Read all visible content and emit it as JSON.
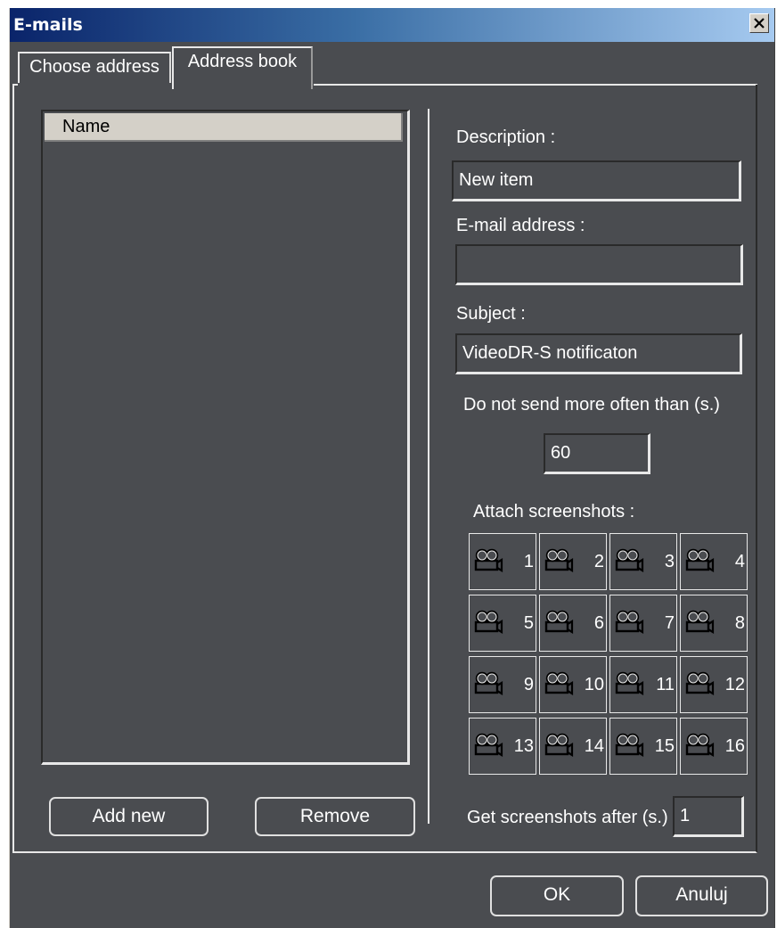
{
  "window": {
    "title": "E-mails"
  },
  "tabs": [
    {
      "label": "Choose address",
      "active": false
    },
    {
      "label": "Address book",
      "active": true
    }
  ],
  "list": {
    "column_header": "Name",
    "rows": []
  },
  "buttons": {
    "add_new": "Add new",
    "remove": "Remove",
    "ok": "OK",
    "cancel": "Anuluj"
  },
  "form": {
    "description_label": "Description :",
    "description_value": "New item",
    "email_label": "E-mail address :",
    "email_value": "",
    "subject_label": "Subject :",
    "subject_value": "VideoDR-S notificaton",
    "interval_label": "Do not send more often than (s.)",
    "interval_value": "60",
    "attach_label": "Attach screenshots :",
    "cameras": [
      "1",
      "2",
      "3",
      "4",
      "5",
      "6",
      "7",
      "8",
      "9",
      "10",
      "11",
      "12",
      "13",
      "14",
      "15",
      "16"
    ],
    "camera_icon": "video-camera-icon",
    "delay_label": "Get screenshots after (s.)",
    "delay_value": "1"
  },
  "colors": {
    "window_bg": "#4a4c50",
    "titlebar_start": "#0a246a",
    "titlebar_end": "#a6caf0",
    "text": "#ffffff"
  }
}
